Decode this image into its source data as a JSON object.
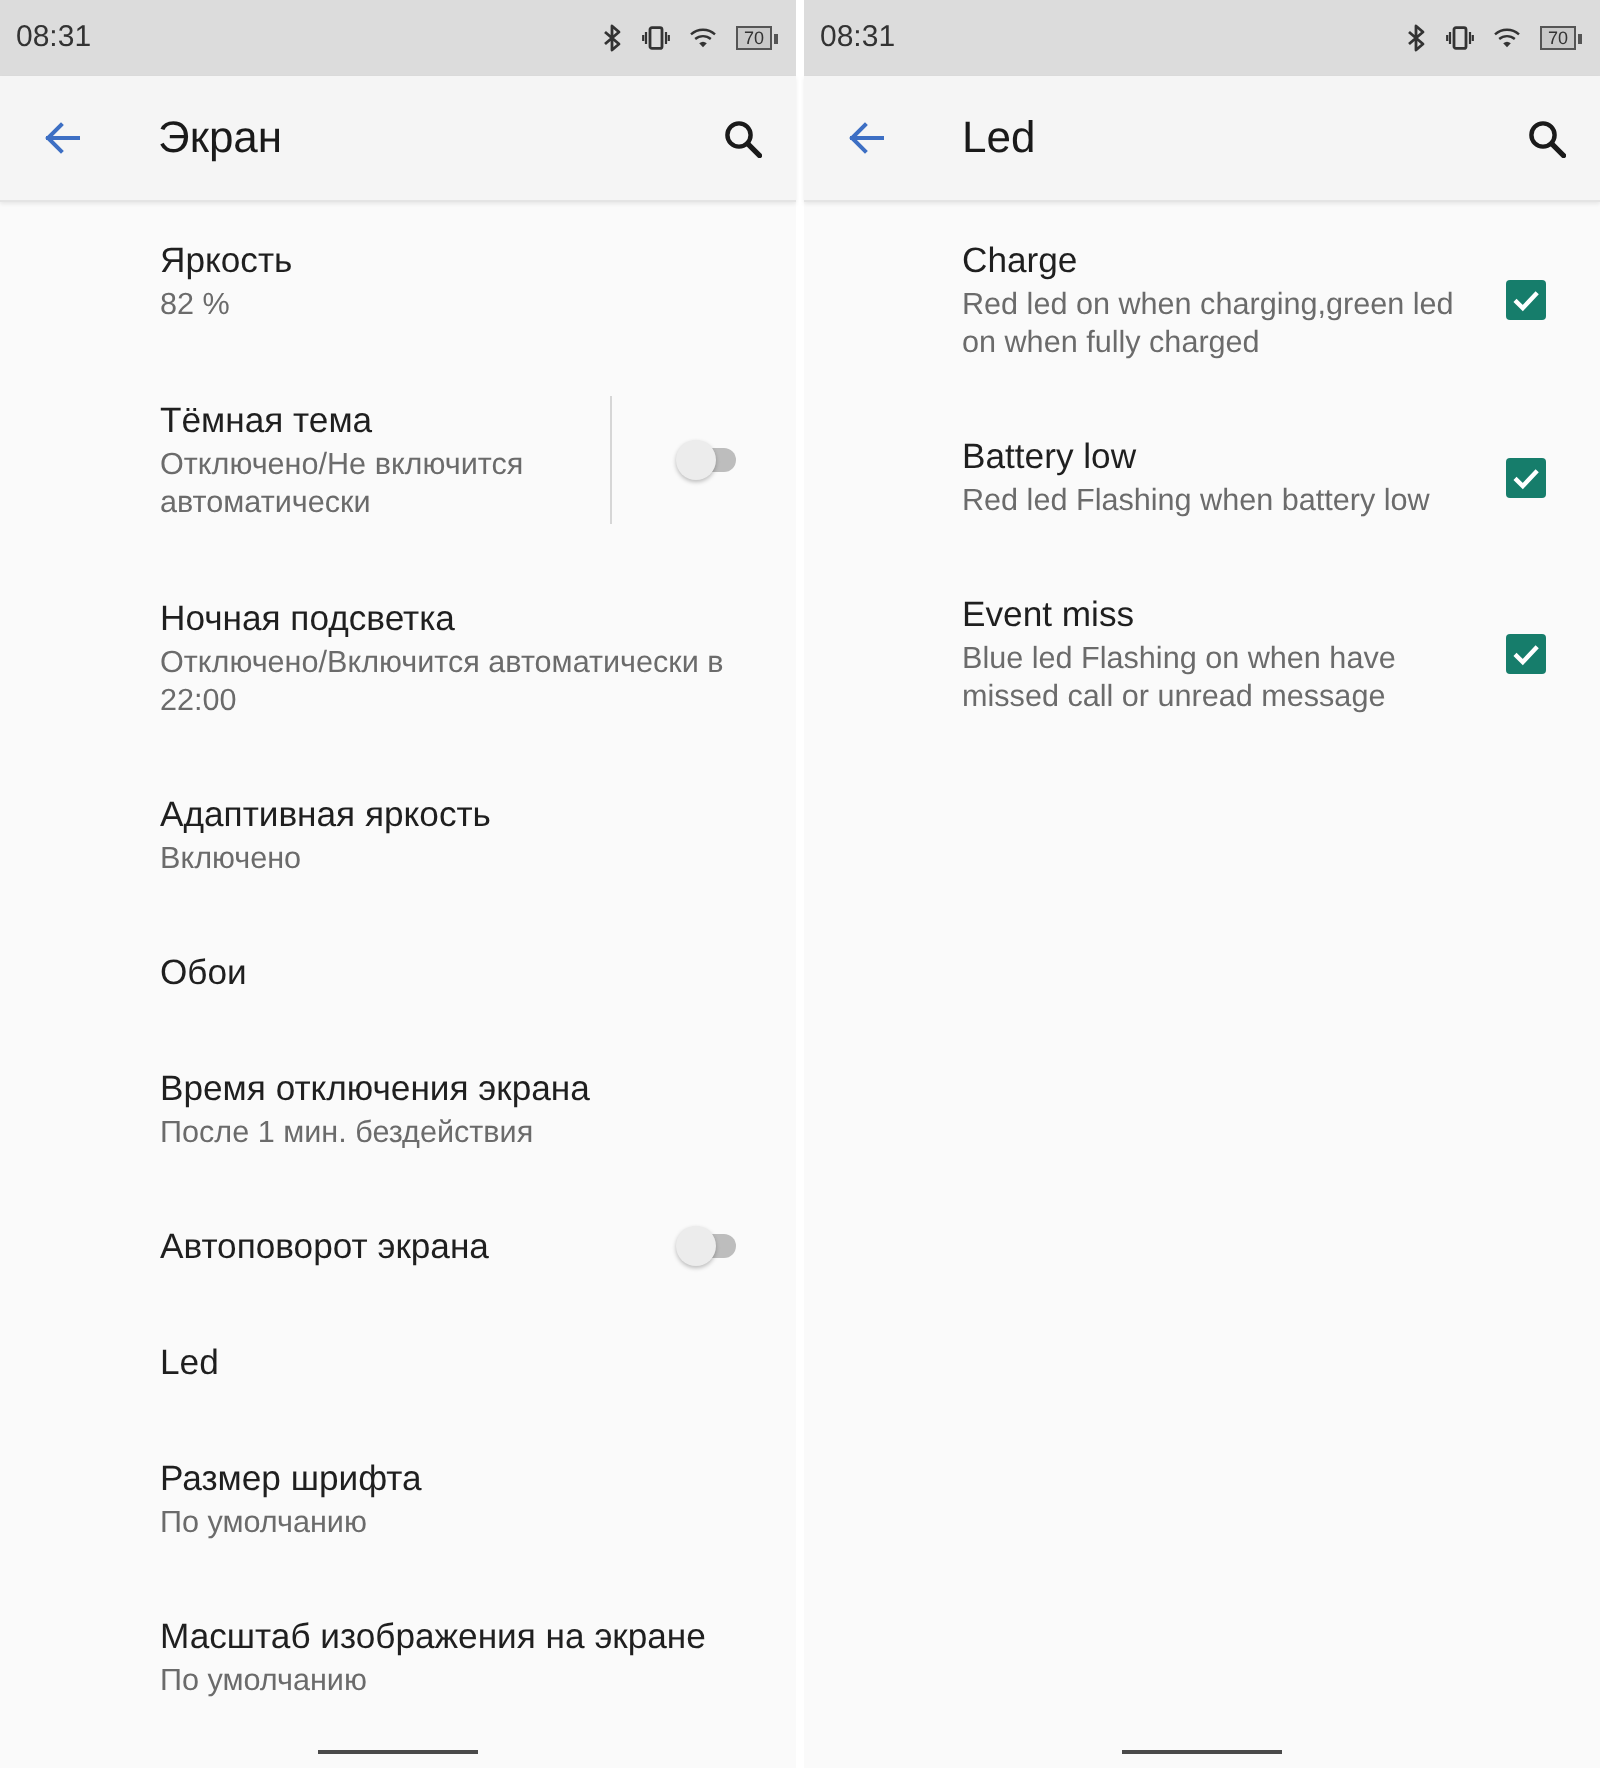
{
  "screens": [
    {
      "status_bar": {
        "time": "08:31",
        "battery": "70"
      },
      "app_bar": {
        "title": "Экран"
      },
      "settings": [
        {
          "kind": "plain",
          "title": "Яркость",
          "summary": "82 %"
        },
        {
          "kind": "split_switch",
          "title": "Тёмная тема",
          "summary": "Отключено/Не включится автоматически",
          "on": false
        },
        {
          "kind": "plain",
          "title": "Ночная подсветка",
          "summary": "Отключено/Включится автоматически в 22:00"
        },
        {
          "kind": "plain",
          "title": "Адаптивная яркость",
          "summary": "Включено"
        },
        {
          "kind": "plain",
          "title": "Обои"
        },
        {
          "kind": "plain",
          "title": "Время отключения экрана",
          "summary": "После 1 мин. бездействия"
        },
        {
          "kind": "switch",
          "title": "Автоповорот экрана",
          "on": false
        },
        {
          "kind": "plain",
          "title": "Led"
        },
        {
          "kind": "plain",
          "title": "Размер шрифта",
          "summary": "По умолчанию"
        },
        {
          "kind": "plain",
          "title": "Масштаб изображения на экране",
          "summary": "По умолчанию"
        }
      ]
    },
    {
      "status_bar": {
        "time": "08:31",
        "battery": "70"
      },
      "app_bar": {
        "title": "Led"
      },
      "settings": [
        {
          "kind": "checkbox",
          "title": "Charge",
          "summary": "Red led on when charging,green led on when fully charged",
          "checked": true
        },
        {
          "kind": "checkbox",
          "title": "Battery low",
          "summary": "Red led Flashing when battery low",
          "checked": true
        },
        {
          "kind": "checkbox",
          "title": "Event miss",
          "summary": "Blue led Flashing on when have missed call or unread message",
          "checked": true
        }
      ]
    }
  ]
}
